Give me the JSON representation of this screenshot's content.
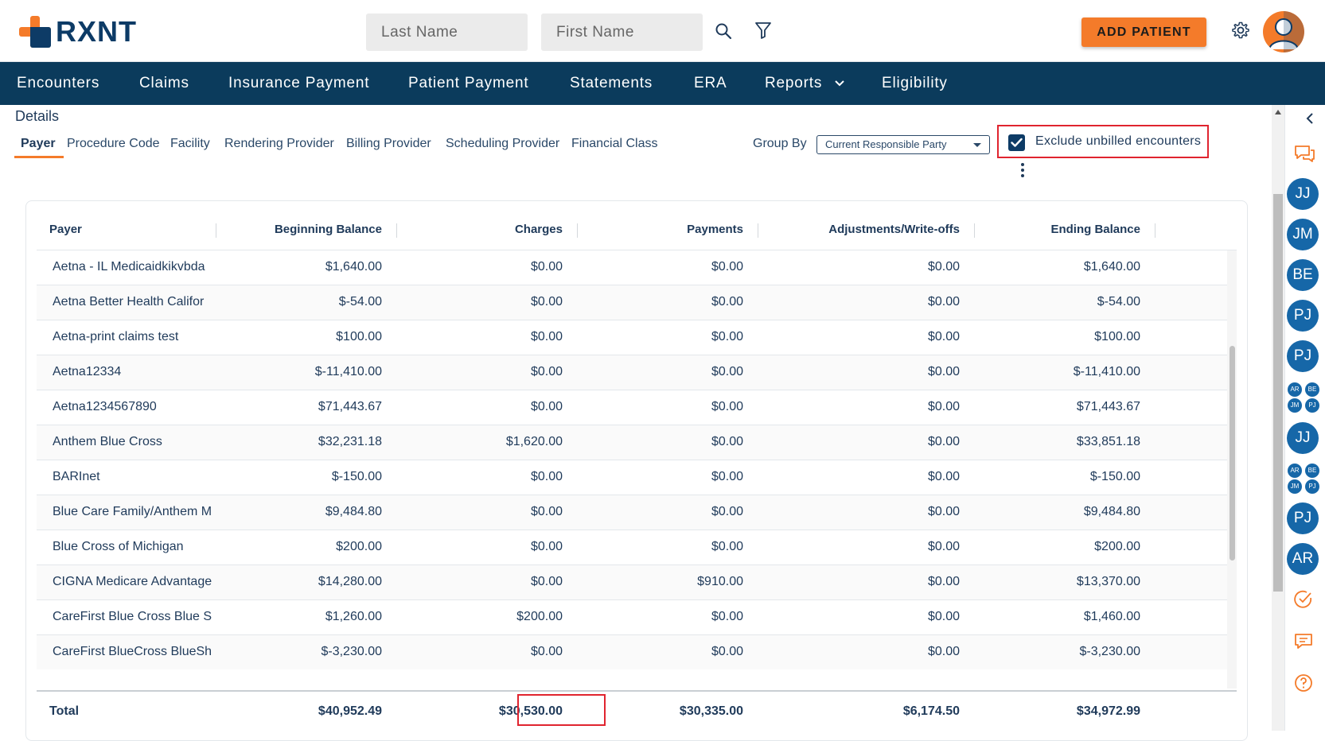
{
  "header": {
    "logo_text": "RXNT",
    "last_name_placeholder": "Last Name",
    "first_name_placeholder": "First Name",
    "add_patient_label": "ADD PATIENT"
  },
  "nav": [
    "Encounters",
    "Claims",
    "Insurance Payment",
    "Patient Payment",
    "Statements",
    "ERA",
    "Reports",
    "Eligibility"
  ],
  "details": {
    "title": "Details",
    "tabs": [
      "Payer",
      "Procedure Code",
      "Facility",
      "Rendering Provider",
      "Billing Provider",
      "Scheduling Provider",
      "Financial Class"
    ],
    "active_tab": "Payer",
    "group_by_label": "Group By",
    "group_by_value": "Current Responsible Party",
    "exclude_label": "Exclude unbilled encounters",
    "exclude_checked": true
  },
  "table": {
    "columns": [
      "Payer",
      "Beginning Balance",
      "Charges",
      "Payments",
      "Adjustments/Write-offs",
      "Ending Balance"
    ],
    "rows": [
      [
        "Aetna - IL Medicaidkikvbda",
        "$1,640.00",
        "$0.00",
        "$0.00",
        "$0.00",
        "$1,640.00"
      ],
      [
        "Aetna Better Health Califor",
        "$-54.00",
        "$0.00",
        "$0.00",
        "$0.00",
        "$-54.00"
      ],
      [
        "Aetna-print claims test",
        "$100.00",
        "$0.00",
        "$0.00",
        "$0.00",
        "$100.00"
      ],
      [
        "Aetna12334",
        "$-11,410.00",
        "$0.00",
        "$0.00",
        "$0.00",
        "$-11,410.00"
      ],
      [
        "Aetna1234567890",
        "$71,443.67",
        "$0.00",
        "$0.00",
        "$0.00",
        "$71,443.67"
      ],
      [
        "Anthem Blue Cross",
        "$32,231.18",
        "$1,620.00",
        "$0.00",
        "$0.00",
        "$33,851.18"
      ],
      [
        "BARInet",
        "$-150.00",
        "$0.00",
        "$0.00",
        "$0.00",
        "$-150.00"
      ],
      [
        "Blue Care Family/Anthem M",
        "$9,484.80",
        "$0.00",
        "$0.00",
        "$0.00",
        "$9,484.80"
      ],
      [
        "Blue Cross of Michigan",
        "$200.00",
        "$0.00",
        "$0.00",
        "$0.00",
        "$200.00"
      ],
      [
        "CIGNA Medicare Advantage",
        "$14,280.00",
        "$0.00",
        "$910.00",
        "$0.00",
        "$13,370.00"
      ],
      [
        "CareFirst Blue Cross Blue S",
        "$1,260.00",
        "$200.00",
        "$0.00",
        "$0.00",
        "$1,460.00"
      ],
      [
        "CareFirst BlueCross BlueSh",
        "$-3,230.00",
        "$0.00",
        "$0.00",
        "$0.00",
        "$-3,230.00"
      ]
    ],
    "total": [
      "Total",
      "$40,952.49",
      "$30,530.00",
      "$30,335.00",
      "$6,174.50",
      "$34,972.99"
    ]
  },
  "right_panel": {
    "avatars": [
      "JJ",
      "JM",
      "BE",
      "PJ",
      "PJ"
    ],
    "group1": [
      "AR",
      "BE",
      "JM",
      "PJ"
    ],
    "avatar_jj2": "JJ",
    "group2": [
      "AR",
      "BE",
      "JM",
      "PJ"
    ],
    "avatar_pj3": "PJ",
    "avatar_ar": "AR"
  },
  "colors": {
    "brand_navy": "#0b3b5c",
    "brand_orange": "#f47b2a",
    "highlight_red": "#e0242f",
    "avatar_blue": "#1667a8"
  }
}
